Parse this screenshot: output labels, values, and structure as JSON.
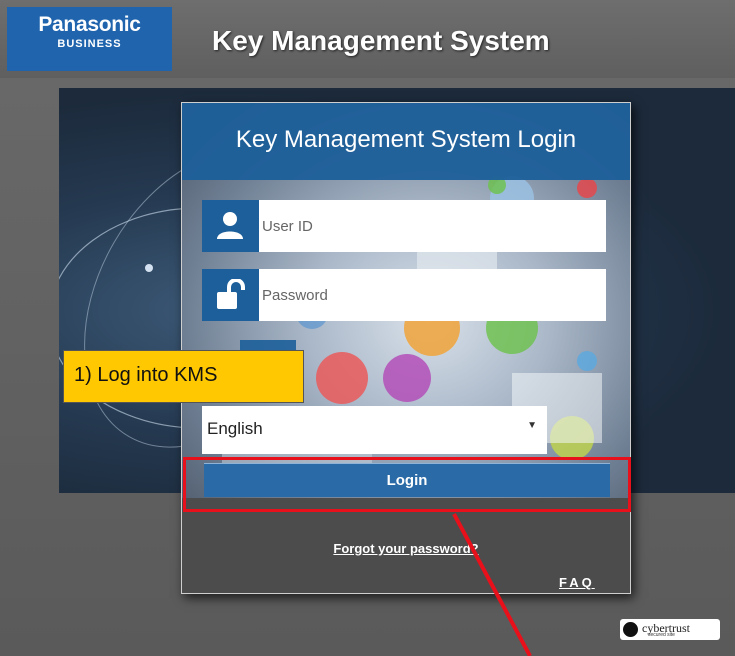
{
  "header": {
    "brand": "Panasonic",
    "brand_sub": "BUSINESS",
    "app_title": "Key Management System"
  },
  "login": {
    "title": "Key Management System Login",
    "user_id_placeholder": "User ID",
    "password_placeholder": "Password",
    "language_selected": "English",
    "language_caret": "▼",
    "login_label": "Login",
    "forgot_label": "Forgot your password?",
    "faq_label": "FAQ"
  },
  "annotations": {
    "callout_text": "1) Log into KMS"
  },
  "footer": {
    "cybertrust_text": "cybertrust",
    "cybertrust_sub": "secured site"
  },
  "colors": {
    "brand_blue": "#1f64ad",
    "panel_blue": "#1c5f9a",
    "highlight_red": "#e8101a",
    "callout_yellow": "#ffc800"
  },
  "icons": {
    "user_field": "user-icon",
    "password_field": "unlock-icon"
  }
}
